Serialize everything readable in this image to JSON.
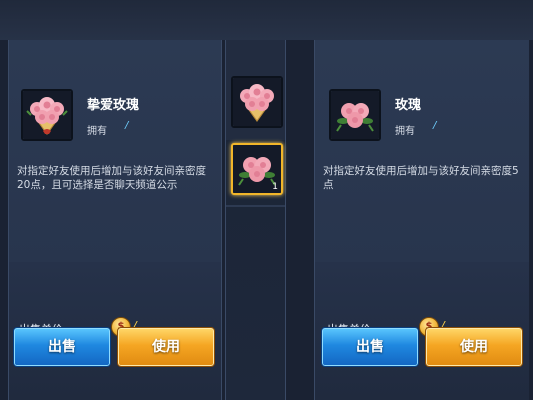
{
  "left_panel": {
    "item_name": "挚爱玫瑰",
    "own_label": "拥有",
    "own_count": "/",
    "description": "对指定好友使用后增加与该好友间亲密度20点，且可选择是否聊天频道公示",
    "price_label": "出售单价",
    "price_value": "/",
    "coin_glyph": "$",
    "sell_button": "出售",
    "use_button": "使用"
  },
  "right_panel": {
    "item_name": "玫瑰",
    "own_label": "拥有",
    "own_count": "/",
    "description": "对指定好友使用后增加与该好友间亲密度5点",
    "price_label": "出售单价",
    "price_value": "/",
    "coin_glyph": "$",
    "sell_button": "出售",
    "use_button": "使用"
  },
  "inventory": {
    "slot2_count": "1"
  },
  "colors": {
    "sell_button": "#1f88e0",
    "use_button": "#f5a623",
    "selected_slot_border": "#f2b62a",
    "own_count": "#6fd0ff"
  },
  "icons": {
    "bouquet": "rose-bouquet-icon",
    "single_rose": "rose-icon",
    "coin": "gold-coin-icon"
  }
}
